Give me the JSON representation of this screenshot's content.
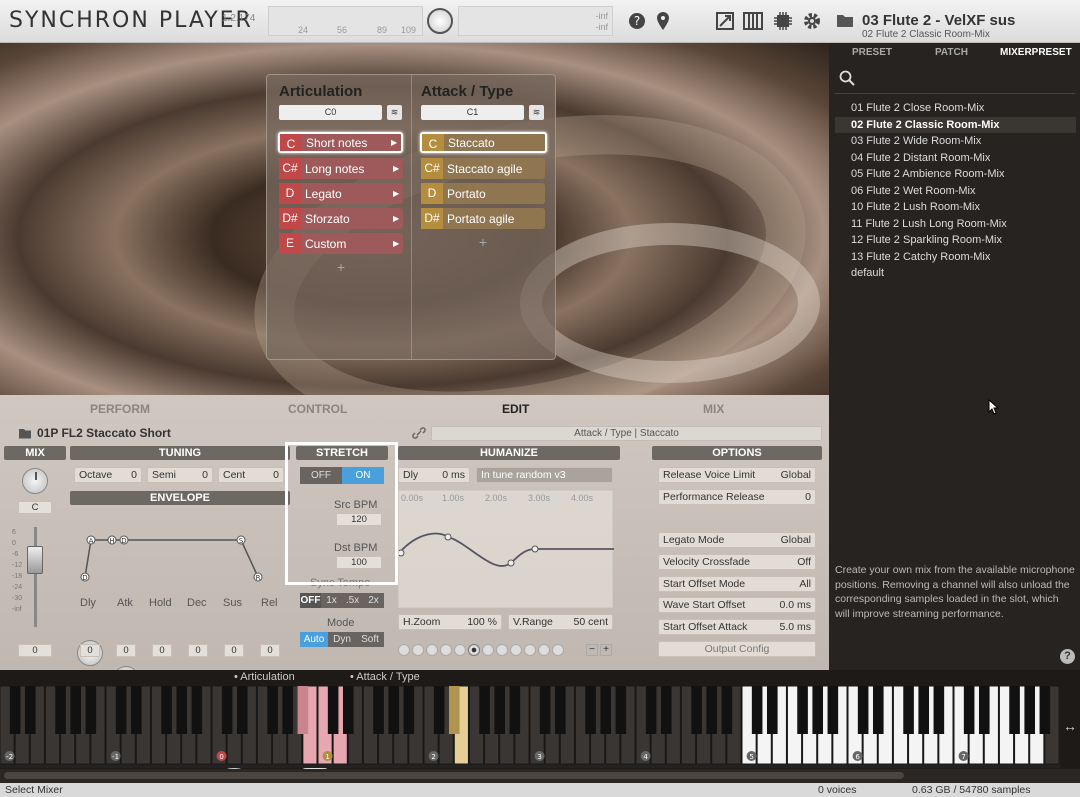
{
  "app": {
    "title": "SYNCHRON PLAYER",
    "version": "1.2.174"
  },
  "meter": {
    "ticks": [
      "24",
      "56",
      "89",
      "109"
    ],
    "inf1": "-inf",
    "inf2": "-inf"
  },
  "patch": {
    "name": "03 Flute 2 - VelXF sus",
    "mixer": "02 Flute 2 Classic Room-Mix"
  },
  "articulation": {
    "title": "Articulation",
    "selector": "C0",
    "rows": [
      {
        "key": "C",
        "label": "Short notes"
      },
      {
        "key": "C#",
        "label": "Long notes"
      },
      {
        "key": "D",
        "label": "Legato"
      },
      {
        "key": "D#",
        "label": "Sforzato"
      },
      {
        "key": "E",
        "label": "Custom"
      }
    ],
    "plus": "+"
  },
  "attack": {
    "title": "Attack / Type",
    "selector": "C1",
    "rows": [
      {
        "key": "C",
        "label": "Staccato"
      },
      {
        "key": "C#",
        "label": "Staccato agile"
      },
      {
        "key": "D",
        "label": "Portato"
      },
      {
        "key": "D#",
        "label": "Portato agile"
      }
    ],
    "plus": "+"
  },
  "sidebar": {
    "tabs": [
      "PRESET",
      "PATCH",
      "MIXERPRESET"
    ],
    "active_tab": "MIXERPRESET",
    "presets": [
      "01 Flute 2 Close Room-Mix",
      "02 Flute 2 Classic Room-Mix",
      "03 Flute 2 Wide Room-Mix",
      "04 Flute 2 Distant Room-Mix",
      "05 Flute 2 Ambience Room-Mix",
      "06 Flute 2 Wet Room-Mix",
      "10 Flute 2 Lush Room-Mix",
      "11 Flute 2 Lush Long Room-Mix",
      "12 Flute 2 Sparkling Room-Mix",
      "13 Flute 2 Catchy Room-Mix",
      "default"
    ],
    "selected": "02 Flute 2 Classic Room-Mix",
    "help": "Create your own mix from the available microphone positions. Removing a channel will also unload the corresponding samples loaded in the slot, which will improve streaming performance."
  },
  "tabs": {
    "perform": "PERFORM",
    "control": "CONTROL",
    "edit": "EDIT",
    "mix": "MIX"
  },
  "edit": {
    "preset": "01P FL2 Staccato Short",
    "breadcrumb": "Attack / Type | Staccato",
    "mix": {
      "title": "MIX",
      "pan": "C",
      "value": "0",
      "scale": [
        "6",
        "0",
        "-6",
        "-12",
        "-18",
        "-24",
        "-30",
        "-inf"
      ]
    },
    "tuning": {
      "title": "TUNING",
      "octave_label": "Octave",
      "octave": "0",
      "semi_label": "Semi",
      "semi": "0",
      "cent_label": "Cent",
      "cent": "0"
    },
    "envelope": {
      "title": "ENVELOPE",
      "points": [
        "A",
        "H",
        "D",
        "S",
        "R"
      ],
      "knobs": [
        {
          "label": "Dly",
          "value": "0"
        },
        {
          "label": "Atk",
          "value": "0"
        },
        {
          "label": "Hold",
          "value": "0"
        },
        {
          "label": "Dec",
          "value": "0"
        },
        {
          "label": "Sus",
          "value": "0"
        },
        {
          "label": "Rel",
          "value": "0"
        }
      ]
    },
    "stretch": {
      "title": "STRETCH",
      "off": "OFF",
      "on": "ON",
      "src_label": "Src BPM",
      "src": "120",
      "dst_label": "Dst BPM",
      "dst": "100",
      "sync_label": "Sync Tempo",
      "sync": [
        "OFF",
        "1x",
        ".5x",
        "2x"
      ],
      "mode_label": "Mode",
      "modes": [
        "Auto",
        "Dyn",
        "Soft"
      ]
    },
    "humanize": {
      "title": "HUMANIZE",
      "dly_label": "Dly",
      "dly": "0 ms",
      "preset": "In tune random v3",
      "times": [
        "0.00s",
        "1.00s",
        "2.00s",
        "3.00s",
        "4.00s"
      ],
      "hzoom_label": "H.Zoom",
      "hzoom": "100 %",
      "vrange_label": "V.Range",
      "vrange": "50 cent"
    },
    "options": {
      "title": "OPTIONS",
      "rows": [
        {
          "label": "Release Voice Limit",
          "value": "Global"
        },
        {
          "label": "Performance Release",
          "value": "0"
        },
        {
          "label": "Legato Mode",
          "value": "Global"
        },
        {
          "label": "Velocity Crossfade",
          "value": "Off"
        },
        {
          "label": "Start Offset Mode",
          "value": "All"
        },
        {
          "label": "Wave Start Offset",
          "value": "0.0 ms"
        },
        {
          "label": "Start Offset Attack",
          "value": "5.0 ms"
        }
      ],
      "output": "Output Config"
    }
  },
  "keyboard": {
    "label1": "• Articulation",
    "label2": "• Attack / Type",
    "octaves": [
      "-2",
      "-1",
      "0",
      "1",
      "2",
      "3",
      "4",
      "5",
      "6",
      "7"
    ]
  },
  "status": {
    "left": "Select Mixer",
    "voices": "0 voices",
    "memory": "0.63 GB / 54780 samples"
  },
  "colors": {
    "articulation": "#c14848",
    "attack": "#b48e3e",
    "accent": "#4aa0dc",
    "highlight": "#ffffff"
  }
}
